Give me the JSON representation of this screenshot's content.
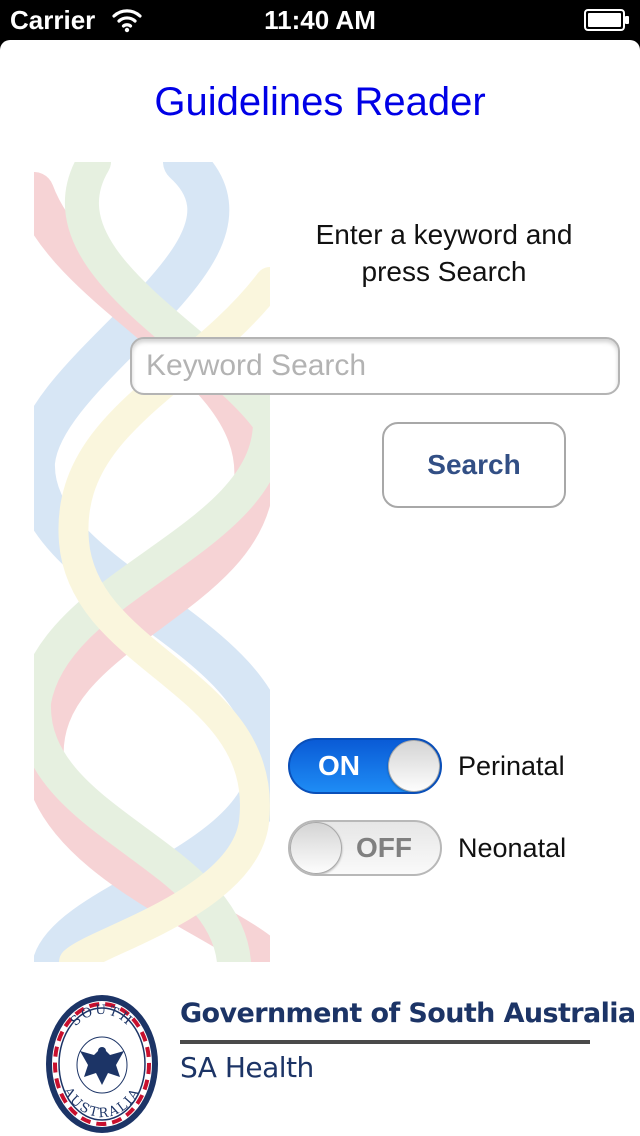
{
  "status_bar": {
    "carrier": "Carrier",
    "time": "11:40 AM",
    "wifi_icon": "wifi-icon",
    "battery_icon": "battery-icon"
  },
  "app": {
    "title": "Guidelines Reader",
    "title_color": "#0000e6",
    "background_icon": "dna-helix-icon"
  },
  "search": {
    "instruction": "Enter a keyword and press Search",
    "placeholder": "Keyword Search",
    "value": "",
    "button_label": "Search",
    "button_color": "#324f85"
  },
  "toggles": [
    {
      "label": "Perinatal",
      "state_text": "ON",
      "on": true
    },
    {
      "label": "Neonatal",
      "state_text": "OFF",
      "on": false
    }
  ],
  "footer": {
    "government_name": "Government of South Australia",
    "department": "SA Health",
    "crest_text_top": "SOUTH",
    "crest_text_bottom": "AUSTRALIA",
    "crest_icon": "piping-shrike-crest-icon",
    "brand_color": "#1c3466"
  }
}
